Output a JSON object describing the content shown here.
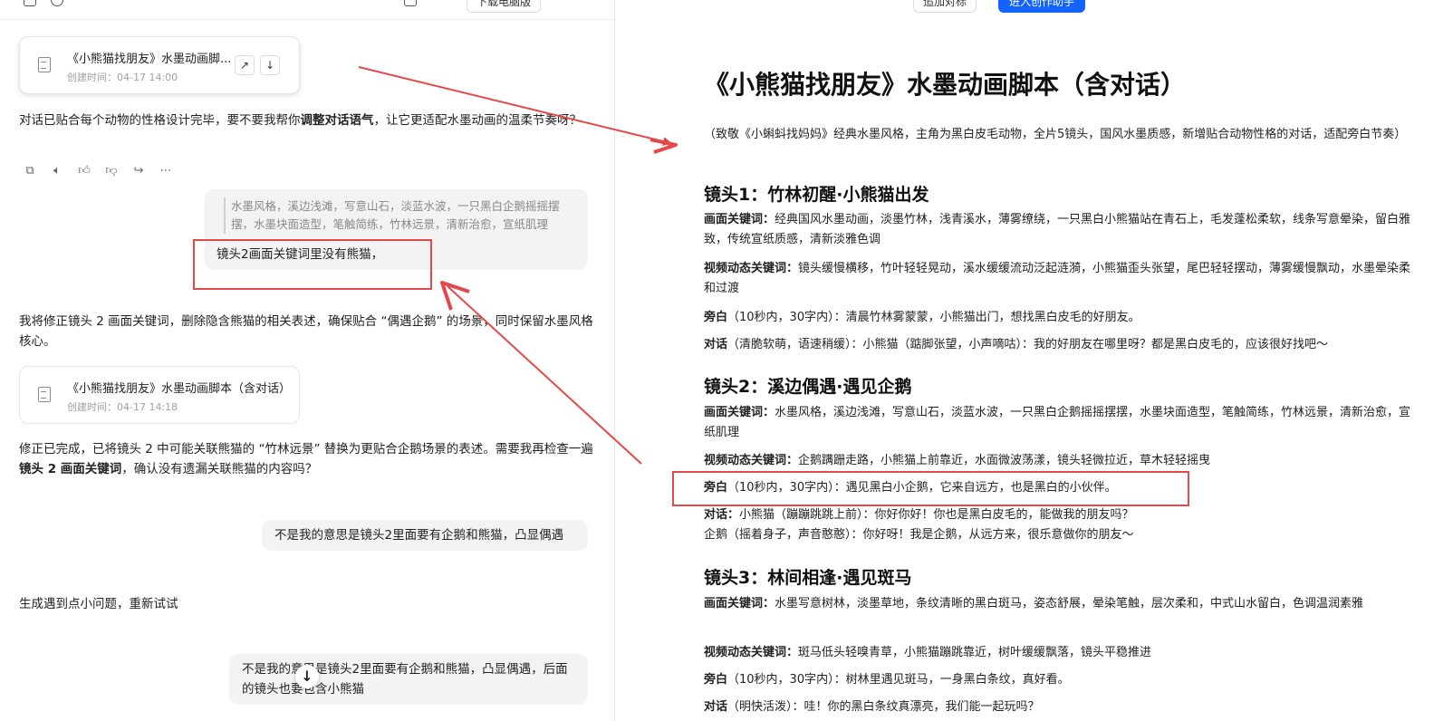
{
  "topbar": {
    "download_label": "下载电脑版",
    "left_pill": "追加对标",
    "right_button": "进入创作助手"
  },
  "chat": {
    "file_card_1": {
      "title": "《小熊猫找朋友》水墨动画脚...",
      "time": "创建时间：04-17 14:00"
    },
    "ai_msg_1_pre": "对话已贴合每个动物的性格设计完毕，要不要我帮你",
    "ai_msg_1_bold": "调整对话语气",
    "ai_msg_1_post": "，让它更适配水墨动画的温柔节奏呀？",
    "quote_text": "水墨风格，溪边浅滩，写意山石，淡蓝水波，一只黑白企鹅摇摇摆摆，水墨块面造型，笔触简练，竹林远景，清新治愈，宣纸肌理",
    "user_msg_1": "镜头2画面关键词里没有熊猫，",
    "ai_msg_2": "我将修正镜头 2 画面关键词，删除隐含熊猫的相关表述，确保贴合 “偶遇企鹅” 的场景，同时保留水墨风格核心。",
    "file_card_2": {
      "title": "《小熊猫找朋友》水墨动画脚本（含对话）",
      "time": "创建时间：04-17 14:18"
    },
    "ai_msg_3_pre": "修正已完成，已将镜头 2 中可能关联熊猫的 “竹林远景” 替换为更贴合企鹅场景的表述。需要我再检查一遍",
    "ai_msg_3_bold": "镜头 2 画面关键词",
    "ai_msg_3_post": "，确认没有遗漏关联熊猫的内容吗？",
    "user_msg_2": "不是我的意思是镜头2里面要有企鹅和熊猫，凸显偶遇",
    "ai_msg_4": "生成遇到点小问题，重新试试",
    "user_msg_3": "不是我的意思是镜头2里面要有企鹅和熊猫，凸显偶遇，后面的镜头也要包含小熊猫",
    "scroll_icon": "arrow-down-icon"
  },
  "doc": {
    "title": "《小熊猫找朋友》水墨动画脚本（含对话）",
    "subtitle": "（致敬《小蝌蚪找妈妈》经典水墨风格，主角为黑白皮毛动物，全片5镜头，国风水墨质感，新增贴合动物性格的对话，适配旁白节奏）",
    "shots": [
      {
        "heading": "镜头1：竹林初醒·小熊猫出发",
        "lines": [
          {
            "k": "画面关键词：",
            "v": "经典国风水墨动画，淡墨竹林，浅青溪水，薄雾缭绕，一只黑白小熊猫站在青石上，毛发蓬松柔软，线条写意晕染，留白雅致，传统宣纸质感，清新淡雅色调"
          },
          {
            "k": "视频动态关键词：",
            "v": "镜头缓慢横移，竹叶轻轻晃动，溪水缓缓流动泛起涟漪，小熊猫歪头张望，尾巴轻轻摆动，薄雾缓慢飘动，水墨晕染柔和过渡"
          },
          {
            "k": "旁白",
            "v": "（10秒内，30字内）：清晨竹林雾蒙蒙，小熊猫出门，想找黑白皮毛的好朋友。"
          },
          {
            "k": "对话",
            "v": "（清脆软萌，语速稍缓）：小熊猫（踮脚张望，小声嘀咕）：我的好朋友在哪里呀？都是黑白皮毛的，应该很好找吧～"
          }
        ]
      },
      {
        "heading": "镜头2：溪边偶遇·遇见企鹅",
        "lines": [
          {
            "k": "画面关键词：",
            "v": "水墨风格，溪边浅滩，写意山石，淡蓝水波，一只黑白企鹅摇摇摆摆，水墨块面造型，笔触简练，竹林远景，清新治愈，宣纸肌理"
          },
          {
            "k": "视频动态关键词：",
            "v": "企鹅蹒跚走路，小熊猫上前靠近，水面微波荡漾，镜头轻微拉近，草木轻轻摇曳"
          },
          {
            "k": "旁白",
            "v": "（10秒内，30字内）：遇见黑白小企鹅，它来自远方，也是黑白的小伙伴。"
          },
          {
            "k": "对话：",
            "v": "小熊猫（蹦蹦跳跳上前）：你好你好！你也是黑白皮毛的，能做我的朋友吗？"
          },
          {
            "k": "",
            "v": "企鹅（摇着身子，声音憨憨）：你好呀！我是企鹅，从远方来，很乐意做你的朋友～"
          }
        ]
      },
      {
        "heading": "镜头3：林间相逢·遇见斑马",
        "lines": [
          {
            "k": "画面关键词：",
            "v": "水墨写意树林，淡墨草地，条纹清晰的黑白斑马，姿态舒展，晕染笔触，层次柔和，中式山水留白，色调温润素雅"
          },
          {
            "k": "视频动态关键词：",
            "v": "斑马低头轻嗅青草，小熊猫蹦跳靠近，树叶缓缓飘落，镜头平稳推进"
          },
          {
            "k": "旁白",
            "v": "（10秒内，30字内）：树林里遇见斑马，一身黑白条纹，真好看。"
          },
          {
            "k": "对话",
            "v": "（明快活泼）：哇！你的黑白条纹真漂亮，我们能一起玩吗？"
          }
        ]
      }
    ]
  },
  "colors": {
    "accent": "#1463ff",
    "annotation": "#e44848"
  }
}
